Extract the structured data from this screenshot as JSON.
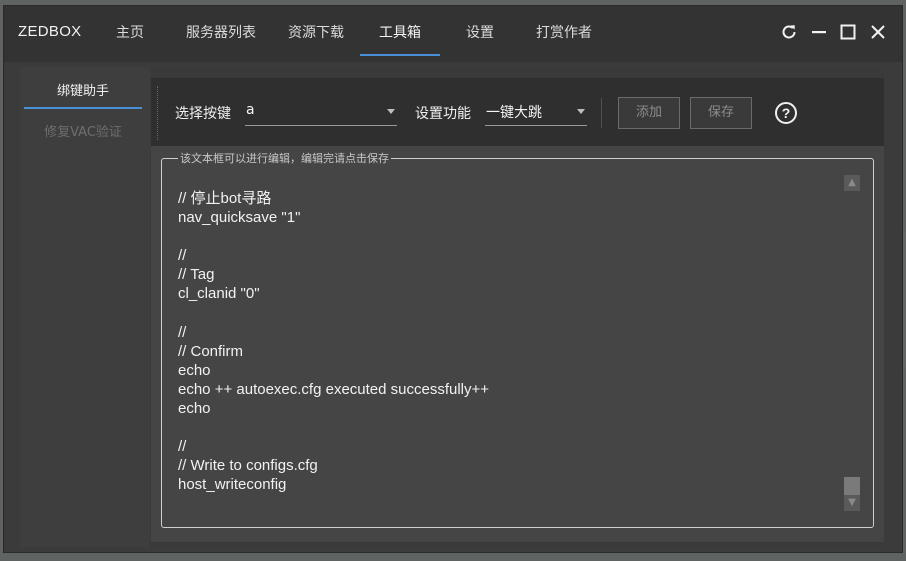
{
  "app": {
    "title": "ZEDBOX"
  },
  "nav": {
    "tabs": [
      {
        "label": "主页"
      },
      {
        "label": "服务器列表"
      },
      {
        "label": "资源下载"
      },
      {
        "label": "工具箱"
      },
      {
        "label": "设置"
      },
      {
        "label": "打赏作者"
      }
    ],
    "active_index": 3
  },
  "window_controls": [
    "refresh-icon",
    "minimize-icon",
    "maximize-icon",
    "close-icon"
  ],
  "sidebar": {
    "items": [
      {
        "label": "绑键助手",
        "active": true
      },
      {
        "label": "修复VAC验证",
        "active": false
      }
    ]
  },
  "toolbar": {
    "key_label": "选择按键",
    "key_value": "a",
    "func_label": "设置功能",
    "func_value": "一键大跳",
    "add_label": "添加",
    "save_label": "保存",
    "help_label": "?"
  },
  "editor": {
    "legend": "该文本框可以进行编辑，编辑完请点击保存",
    "content": "// 停止bot寻路\nnav_quicksave \"1\"\n\n//\n// Tag\ncl_clanid \"0\"\n\n//\n// Confirm\necho\necho ++ autoexec.cfg executed successfully++\necho\n\n//\n// Write to configs.cfg\nhost_writeconfig"
  },
  "colors": {
    "accent": "#4a90d9",
    "titlebar": "#333333",
    "panel": "#454545",
    "toolbar": "#2f2f2f"
  }
}
